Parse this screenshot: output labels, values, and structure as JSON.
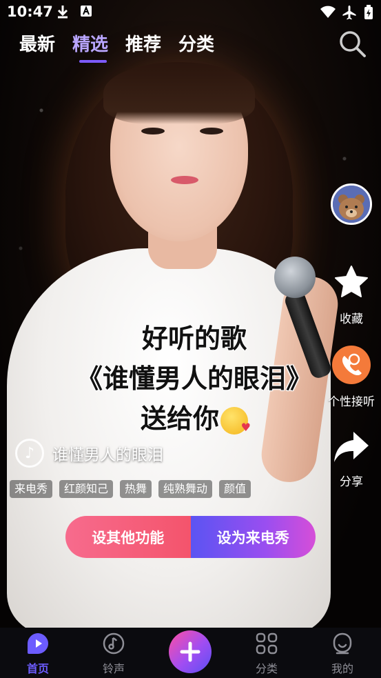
{
  "status_bar": {
    "time": "10:47",
    "icons": [
      "download-icon",
      "a-letter-icon",
      "wifi-icon",
      "airplane-icon",
      "battery-icon"
    ]
  },
  "top_tabs": [
    {
      "label": "最新",
      "active": false
    },
    {
      "label": "精选",
      "active": true
    },
    {
      "label": "推荐",
      "active": false
    },
    {
      "label": "分类",
      "active": false
    }
  ],
  "caption": {
    "line1": "好听的歌",
    "line2": "《谁懂男人的眼泪》",
    "line3": "送给你"
  },
  "song": {
    "title": "谁懂男人的眼泪"
  },
  "tags": [
    "来电秀",
    "红颜知己",
    "热舞",
    "纯熟舞动",
    "颜值"
  ],
  "side_actions": {
    "favorite": "收藏",
    "ringtone": "个性接听",
    "share": "分享"
  },
  "buttons": {
    "other_functions": "设其他功能",
    "set_call_show": "设为来电秀"
  },
  "bottom_nav": [
    {
      "label": "首页",
      "icon": "home-play-icon",
      "active": true
    },
    {
      "label": "铃声",
      "icon": "music-note-icon",
      "active": false
    },
    {
      "label": "",
      "icon": "plus-icon",
      "active": false
    },
    {
      "label": "分类",
      "icon": "grid-icon",
      "active": false
    },
    {
      "label": "我的",
      "icon": "profile-icon",
      "active": false
    }
  ],
  "colors": {
    "active_tab": "#b9a6ff",
    "accent": "#6c5cff",
    "left_button": "#f4546c",
    "right_button": "#7a50f1"
  }
}
